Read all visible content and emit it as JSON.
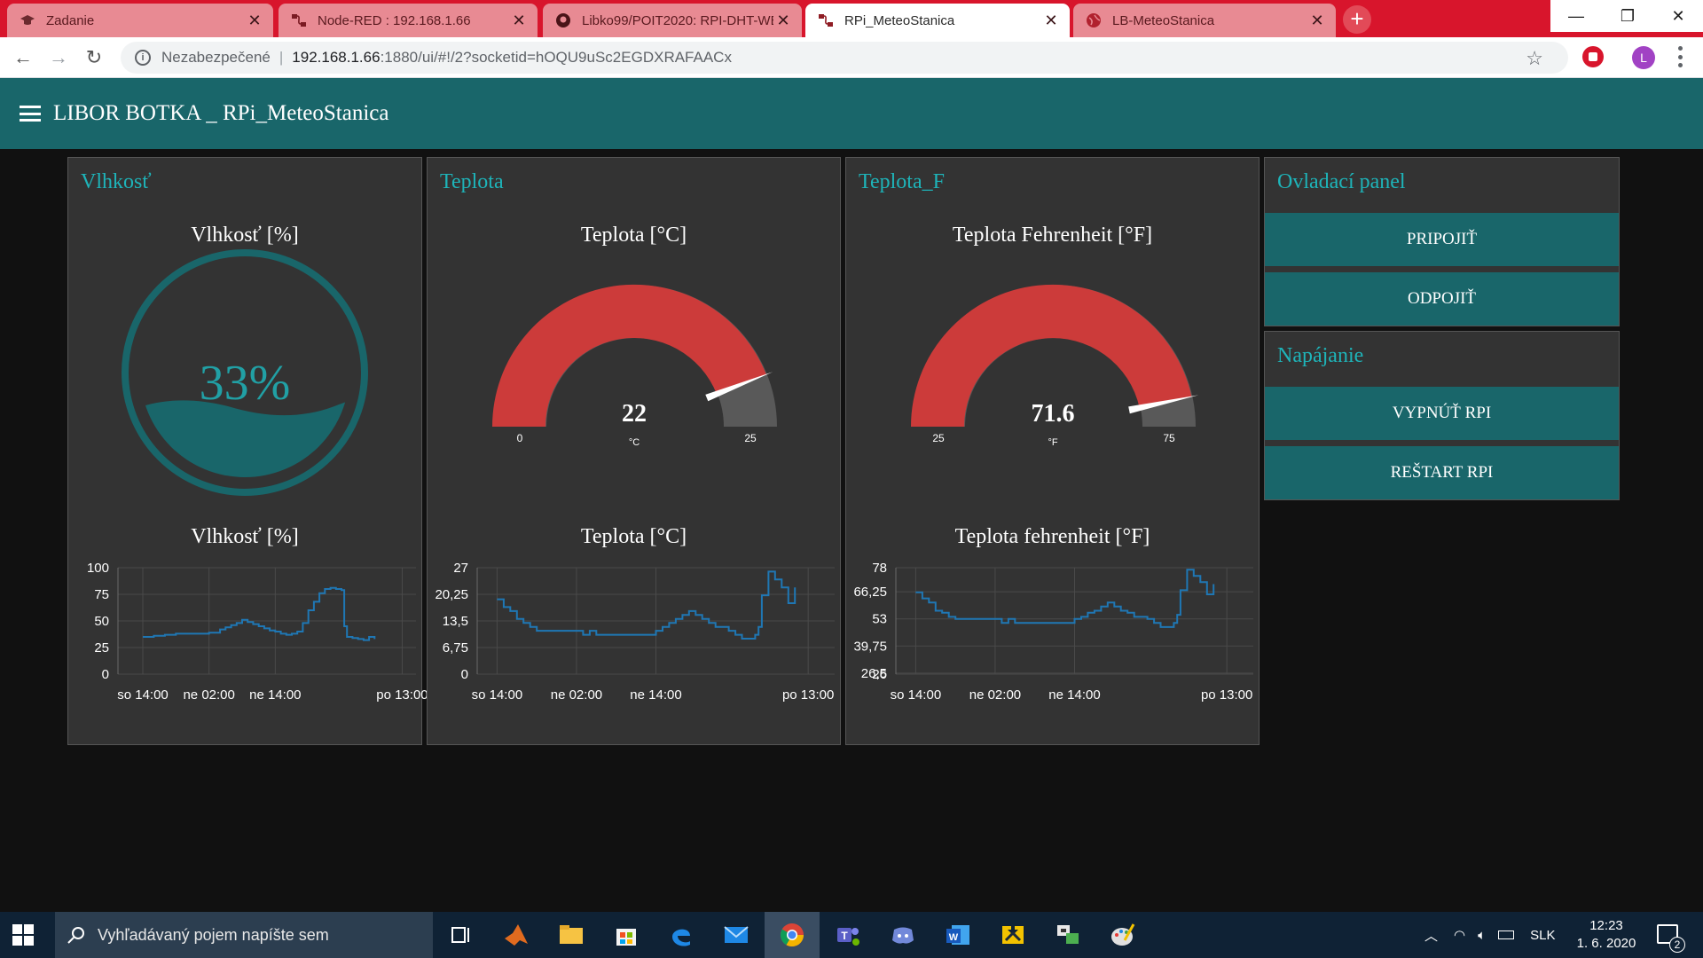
{
  "browser": {
    "tabs": [
      {
        "label": "Zadanie",
        "icon": "mortarboard-icon",
        "active": false
      },
      {
        "label": "Node-RED : 192.168.1.66",
        "icon": "node-red-icon",
        "active": false
      },
      {
        "label": "Libko99/POIT2020: RPI-DHT-WEB",
        "icon": "github-icon",
        "active": false
      },
      {
        "label": "RPi_MeteoStanica",
        "icon": "node-red-icon",
        "active": true
      },
      {
        "label": "LB-MeteoStanica",
        "icon": "globe-icon",
        "active": false
      }
    ],
    "address": {
      "security_label": "Nezabezpečené",
      "host": "192.168.1.66",
      "path": ":1880/ui/#!/2?socketid=hOQU9uSc2EGDXRAFAACx"
    },
    "profile_initial": "L"
  },
  "dashboard": {
    "title": "LIBOR BOTKA _ RPi_MeteoStanica",
    "groups": {
      "humidity": {
        "title": "Vlhkosť",
        "gauge_label": "Vlhkosť [%]",
        "gauge_value": "33%",
        "gauge_fraction": 0.33,
        "chart_label": "Vlhkosť [%]"
      },
      "temperature": {
        "title": "Teplota",
        "gauge_label": "Teplota [°C]",
        "gauge_value": "22",
        "gauge_unit": "°C",
        "gauge_min": "0",
        "gauge_max": "25",
        "chart_label": "Teplota [°C]"
      },
      "temperature_f": {
        "title": "Teplota_F",
        "gauge_label": "Teplota Fehrenheit [°F]",
        "gauge_value": "71.6",
        "gauge_unit": "°F",
        "gauge_min": "25",
        "gauge_max": "75",
        "chart_label": "Teplota fehrenheit [°F]"
      },
      "control": {
        "title": "Ovladací panel",
        "buttons": [
          "PRIPOJIŤ",
          "ODPOJIŤ"
        ]
      },
      "power": {
        "title": "Napájanie",
        "buttons": [
          "VYPNÚŤ RPI",
          "REŠTART RPI"
        ]
      }
    },
    "colors": {
      "accent": "#19666a",
      "title": "#1eb4b9",
      "gauge": "#cc3b3a",
      "line": "#1f77b4"
    }
  },
  "chart_data": [
    {
      "type": "line",
      "title": "Vlhkosť [%]",
      "yticks": [
        "100",
        "75",
        "50",
        "25",
        "0"
      ],
      "ylim": [
        0,
        100
      ],
      "xticks": [
        "so 14:00",
        "ne 02:00",
        "ne 14:00",
        "po 13:00"
      ],
      "xtick_hours": [
        0,
        12,
        24,
        47
      ],
      "xlim": [
        -4.5,
        49.5
      ],
      "series": [
        {
          "color": "#1f77b4",
          "x": [
            0,
            2,
            4,
            6,
            8,
            10,
            12,
            14,
            15,
            16,
            17,
            18,
            19,
            20,
            21,
            22,
            23,
            24,
            25,
            26,
            27,
            28,
            29,
            30,
            31,
            32,
            33,
            34,
            35,
            36,
            36.5,
            37,
            38,
            39,
            40,
            41,
            42
          ],
          "y": [
            35,
            36,
            37,
            38,
            38,
            38,
            39,
            42,
            44,
            46,
            48,
            51,
            49,
            47,
            45,
            43,
            41,
            40,
            38,
            37,
            38,
            40,
            48,
            60,
            68,
            76,
            80,
            81,
            80,
            79,
            45,
            35,
            34,
            33,
            32,
            35,
            33
          ]
        }
      ]
    },
    {
      "type": "line",
      "title": "Teplota [°C]",
      "yticks": [
        "27",
        "20,25",
        "13,5",
        "6,75",
        "0"
      ],
      "ylim": [
        0,
        27
      ],
      "xticks": [
        "so 14:00",
        "ne 02:00",
        "ne 14:00",
        "po 13:00"
      ],
      "xtick_hours": [
        0,
        12,
        24,
        47
      ],
      "xlim": [
        -3,
        51
      ],
      "series": [
        {
          "color": "#1f77b4",
          "x": [
            0,
            1,
            2,
            3,
            4,
            5,
            6,
            8,
            10,
            12,
            13,
            14,
            15,
            16,
            18,
            20,
            22,
            24,
            25,
            26,
            27,
            28,
            29,
            30,
            31,
            32,
            33,
            34,
            35,
            36,
            37,
            38,
            39,
            39.5,
            40,
            41,
            42,
            43,
            44,
            45
          ],
          "y": [
            19,
            17,
            16,
            14,
            13,
            12,
            11,
            11,
            11,
            11,
            10,
            11,
            10,
            10,
            10,
            10,
            10,
            11,
            12,
            13,
            14,
            15,
            16,
            15,
            14,
            13,
            12,
            12,
            11,
            10,
            9,
            9,
            10,
            12,
            20,
            26,
            24,
            22,
            18,
            22
          ]
        }
      ]
    },
    {
      "type": "line",
      "title": "Teplota fehrenheit [°F]",
      "yticks": [
        "78",
        "66,25",
        "53",
        "39,75",
        "26,5",
        "26"
      ],
      "ylim": [
        26,
        78
      ],
      "xticks": [
        "so 14:00",
        "ne 02:00",
        "ne 14:00",
        "po 13:00"
      ],
      "xtick_hours": [
        0,
        12,
        24,
        47
      ],
      "xlim": [
        -3,
        51
      ],
      "series": [
        {
          "color": "#1f77b4",
          "x": [
            0,
            1,
            2,
            3,
            4,
            5,
            6,
            8,
            10,
            12,
            13,
            14,
            15,
            16,
            18,
            20,
            22,
            24,
            25,
            26,
            27,
            28,
            29,
            30,
            31,
            32,
            33,
            34,
            35,
            36,
            37,
            38,
            39,
            39.5,
            40,
            41,
            42,
            43,
            44,
            45
          ],
          "y": [
            66,
            63,
            61,
            57,
            56,
            54,
            53,
            53,
            53,
            53,
            51,
            53,
            51,
            51,
            51,
            51,
            51,
            53,
            54,
            56,
            57,
            59,
            61,
            59,
            57,
            56,
            54,
            54,
            53,
            51,
            49,
            49,
            51,
            55,
            67,
            77,
            74,
            71,
            65,
            70
          ]
        }
      ]
    }
  ],
  "taskbar": {
    "search_placeholder": "Vyhľadávaný pojem napíšte sem",
    "language": "SLK",
    "time": "12:23",
    "date": "1. 6. 2020",
    "notification_count": "2",
    "apps": [
      "task-view-icon",
      "matlab-icon",
      "file-explorer-icon",
      "store-icon",
      "edge-icon",
      "mail-icon",
      "chrome-icon",
      "teams-icon",
      "discord-icon",
      "word-icon",
      "winscp-icon",
      "network-app-icon",
      "paint-icon"
    ]
  }
}
